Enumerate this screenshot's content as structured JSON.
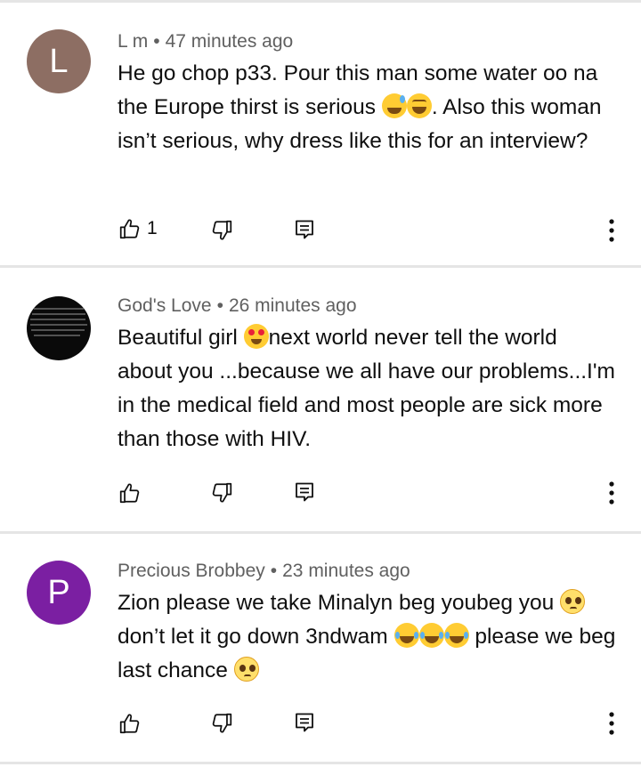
{
  "comments": [
    {
      "author": "L m",
      "time": "47 minutes ago",
      "avatar_letter": "L",
      "avatar_color": "#8d6e63",
      "text_parts": [
        "He go chop p33. Pour this man some water oo na the Europe thirst is serious ",
        ". Also this woman isn’t serious, why dress like this for an interview?"
      ],
      "emojis": [
        "grinning-sweat-emoji",
        "squinting-laugh-emoji"
      ],
      "like_count": "1"
    },
    {
      "author": "God's Love",
      "time": "26 minutes ago",
      "avatar_letter": "",
      "avatar_color": "#0a0a0a",
      "text_parts": [
        "Beautiful girl ",
        "next world never tell the world about you ...because we all have our problems...I'm in the medical field and most people are sick more than those with HIV."
      ],
      "emojis": [
        "heart-eyes-emoji"
      ],
      "like_count": ""
    },
    {
      "author": "Precious Brobbey",
      "time": "23 minutes ago",
      "avatar_letter": "P",
      "avatar_color": "#7b1fa2",
      "text_parts": [
        "Zion please we take Minalyn beg youbeg you ",
        " don’t let it go down 3ndwam ",
        " please we beg last chance "
      ],
      "emojis": [
        "pleading-emoji",
        "joy-emoji",
        "pleading-emoji"
      ],
      "like_count": ""
    }
  ],
  "separator": "•"
}
